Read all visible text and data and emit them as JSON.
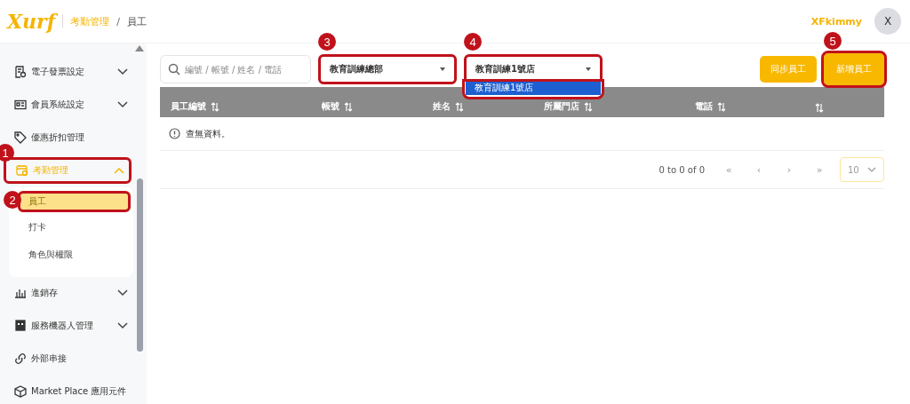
{
  "header": {
    "logo": "Xurf",
    "breadcrumb": [
      {
        "label": "考勤管理"
      },
      {
        "label": "員工"
      }
    ],
    "separator": "/",
    "user": "XFkimmy",
    "avatar": "X"
  },
  "sidebar": {
    "items": [
      {
        "label": "電子發票設定",
        "expandable": true,
        "expanded": false,
        "selected": false
      },
      {
        "label": "會員系統設定",
        "expandable": true,
        "expanded": false,
        "selected": false
      },
      {
        "label": "優惠折扣管理",
        "expandable": false,
        "expanded": false,
        "selected": false
      },
      {
        "label": "考勤管理",
        "expandable": true,
        "expanded": true,
        "selected": true,
        "callout": "1",
        "children": [
          {
            "label": "員工",
            "selected": true,
            "callout": "2"
          },
          {
            "label": "打卡",
            "selected": false
          },
          {
            "label": "角色與權限",
            "selected": false
          }
        ]
      },
      {
        "label": "進銷存",
        "expandable": true,
        "expanded": false,
        "selected": false
      },
      {
        "label": "服務機器人管理",
        "expandable": true,
        "expanded": false,
        "selected": false
      },
      {
        "label": "外部串接",
        "expandable": false,
        "expanded": false,
        "selected": false
      },
      {
        "label": "Market Place 應用元件",
        "expandable": false,
        "expanded": false,
        "selected": false
      }
    ]
  },
  "toolbar": {
    "search": {
      "placeholder": "編號 / 帳號 / 姓名 / 電話"
    },
    "selects": [
      {
        "value": "教育訓練總部",
        "callout": "3",
        "open": false
      },
      {
        "value": "教育訓練1號店",
        "callout": "4",
        "open": true,
        "options": [
          {
            "label": "教育訓練1號店",
            "selected": true
          }
        ]
      }
    ],
    "buttons": [
      {
        "label": "同步員工"
      },
      {
        "label": "新增員工",
        "callout": "5"
      }
    ]
  },
  "table": {
    "columns": [
      {
        "label": "員工編號"
      },
      {
        "label": "帳號"
      },
      {
        "label": "姓名"
      },
      {
        "label": "所屬門店"
      },
      {
        "label": "電話"
      },
      {}
    ],
    "empty_message": "查無資料。"
  },
  "pagination": {
    "summary": "0 to 0 of 0",
    "nav": [
      "«",
      "‹",
      "›",
      "»"
    ],
    "page_size": "10"
  }
}
